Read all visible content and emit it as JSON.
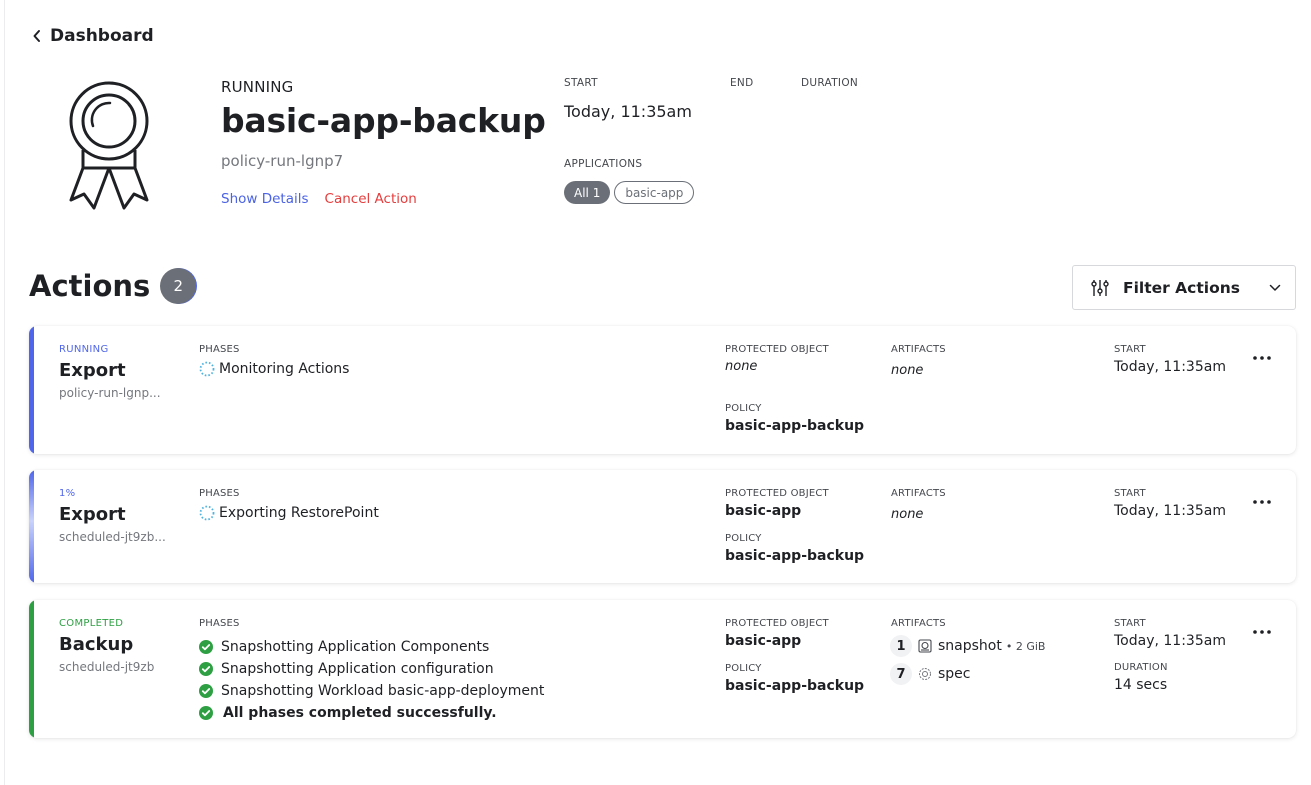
{
  "nav": {
    "back_label": "Dashboard"
  },
  "header": {
    "status": "RUNNING",
    "title": "basic-app-backup",
    "run_id": "policy-run-lgnp7",
    "show_details": "Show Details",
    "cancel_action": "Cancel Action",
    "start_label": "START",
    "start_value": "Today, 11:35am",
    "end_label": "END",
    "end_value": "",
    "duration_label": "DURATION",
    "duration_value": "",
    "applications_label": "APPLICATIONS",
    "applications": [
      {
        "label": "All 1",
        "selected": true
      },
      {
        "label": "basic-app",
        "selected": false
      }
    ]
  },
  "actions": {
    "title": "Actions",
    "count": "2",
    "filter_label": "Filter Actions",
    "labels": {
      "phases": "PHASES",
      "protected_object": "PROTECTED OBJECT",
      "policy": "POLICY",
      "artifacts": "ARTIFACTS",
      "start": "START",
      "duration": "DURATION"
    },
    "items": [
      {
        "status": "RUNNING",
        "status_color": "#5066ea",
        "type": "Export",
        "name": "policy-run-lgnp...",
        "phases": [
          "Monitoring Actions"
        ],
        "protected_object": "none",
        "policy": "basic-app-backup",
        "artifacts": "none",
        "start": "Today, 11:35am"
      },
      {
        "status": "1%",
        "progress_percent": 1,
        "status_color": "#5066ea",
        "type": "Export",
        "name": "scheduled-jt9zb...",
        "phases": [
          "Exporting RestorePoint"
        ],
        "protected_object": "basic-app",
        "policy": "basic-app-backup",
        "artifacts": "none",
        "start": "Today, 11:35am"
      },
      {
        "status": "COMPLETED",
        "status_color": "#2ea043",
        "type": "Backup",
        "name": "scheduled-jt9zb",
        "phases": [
          "Snapshotting Application Components",
          "Snapshotting Application configuration",
          "Snapshotting Workload basic-app-deployment",
          "All phases completed successfully."
        ],
        "protected_object": "basic-app",
        "policy": "basic-app-backup",
        "artifacts_list": [
          {
            "count": "1",
            "icon": "snapshot-icon",
            "label": "snapshot",
            "size": "• 2 GiB"
          },
          {
            "count": "7",
            "icon": "spec-gear-icon",
            "label": "spec",
            "size": ""
          }
        ],
        "start": "Today, 11:35am",
        "duration": "14 secs"
      }
    ]
  },
  "colors": {
    "accent_blue": "#5066ea",
    "success_green": "#2ea043",
    "danger_red": "#e63d3d",
    "link_blue": "#4b63e4",
    "spinner_blue": "#4fb3e0"
  }
}
